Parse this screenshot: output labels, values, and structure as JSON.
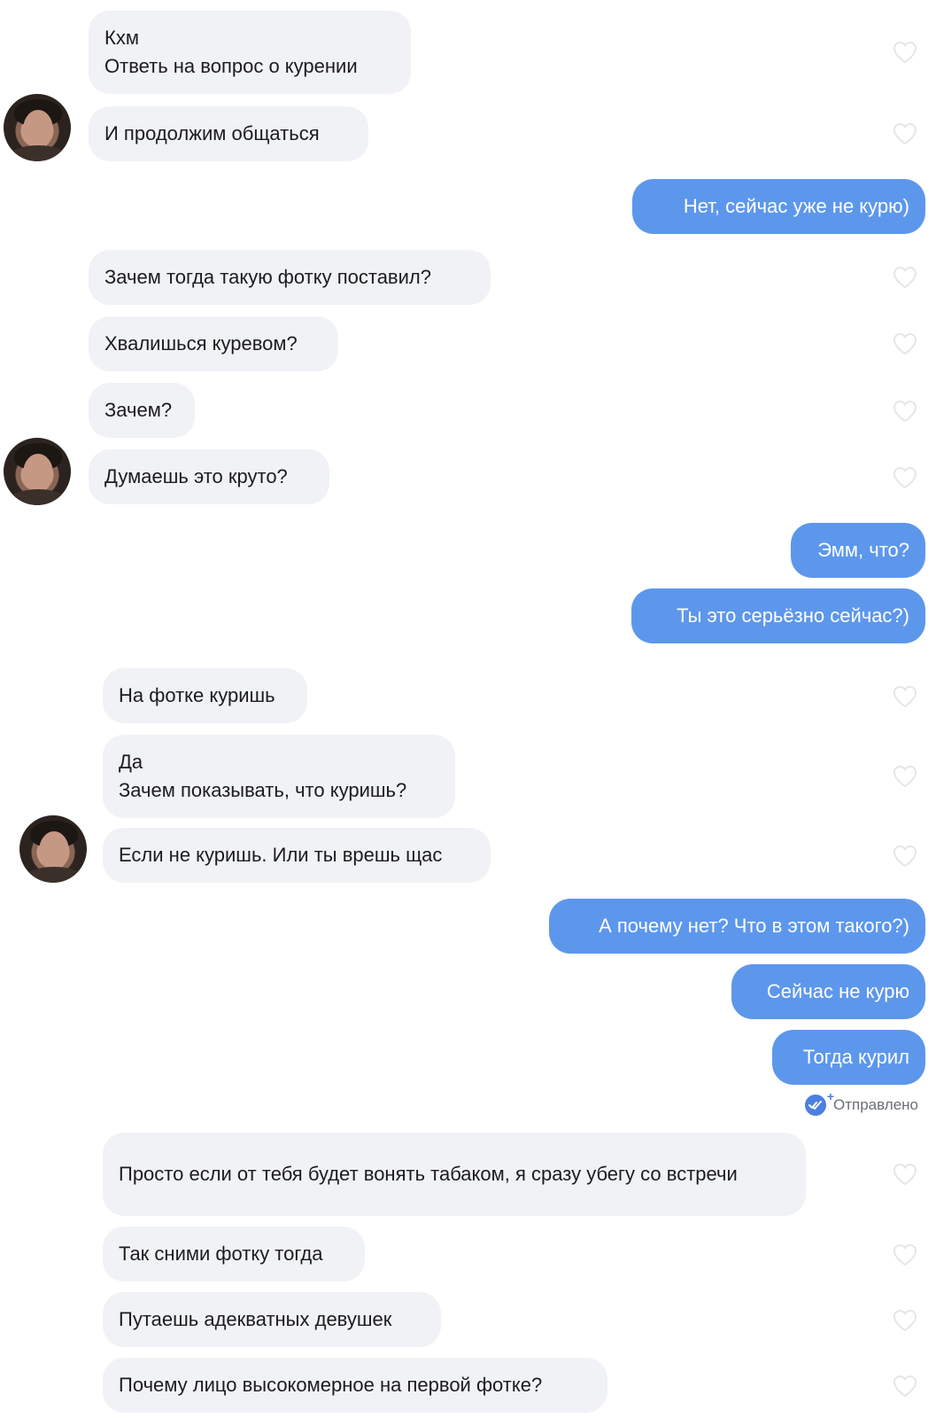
{
  "chat": {
    "messages": [
      {
        "dir": "in",
        "text": "Кхм\nОтветь на вопрос о курении"
      },
      {
        "dir": "in",
        "text": "И продолжим общаться"
      },
      {
        "dir": "out",
        "text": "Нет, сейчас уже не курю)"
      },
      {
        "dir": "in",
        "text": "Зачем тогда такую фотку поставил?"
      },
      {
        "dir": "in",
        "text": "Хвалишься куревом?"
      },
      {
        "dir": "in",
        "text": "Зачем?"
      },
      {
        "dir": "in",
        "text": "Думаешь это круто?"
      },
      {
        "dir": "out",
        "text": "Эмм, что?"
      },
      {
        "dir": "out",
        "text": "Ты это серьёзно сейчас?)"
      },
      {
        "dir": "in",
        "text": "На фотке куришь"
      },
      {
        "dir": "in",
        "text": "Да\nЗачем показывать, что куришь?"
      },
      {
        "dir": "in",
        "text": "Если не куришь. Или ты врешь щас"
      },
      {
        "dir": "out",
        "text": "А почему нет? Что в этом такого?)"
      },
      {
        "dir": "out",
        "text": "Сейчас не курю"
      },
      {
        "dir": "out",
        "text": "Тогда курил"
      },
      {
        "dir": "in",
        "text": "Просто если от тебя будет вонять табаком, я сразу убегу со встречи"
      },
      {
        "dir": "in",
        "text": "Так сними фотку тогда"
      },
      {
        "dir": "in",
        "text": "Путаешь адекватных девушек"
      },
      {
        "dir": "in",
        "text": "Почему лицо высокомерное на первой фотке?"
      }
    ],
    "status_text": "Отправлено",
    "icons": {
      "like": "heart-outline-icon",
      "read": "double-check-icon"
    },
    "colors": {
      "incoming_bg": "#f0f2f5",
      "outgoing_bg": "#5d97ec",
      "outgoing_text": "#ffffff"
    }
  }
}
